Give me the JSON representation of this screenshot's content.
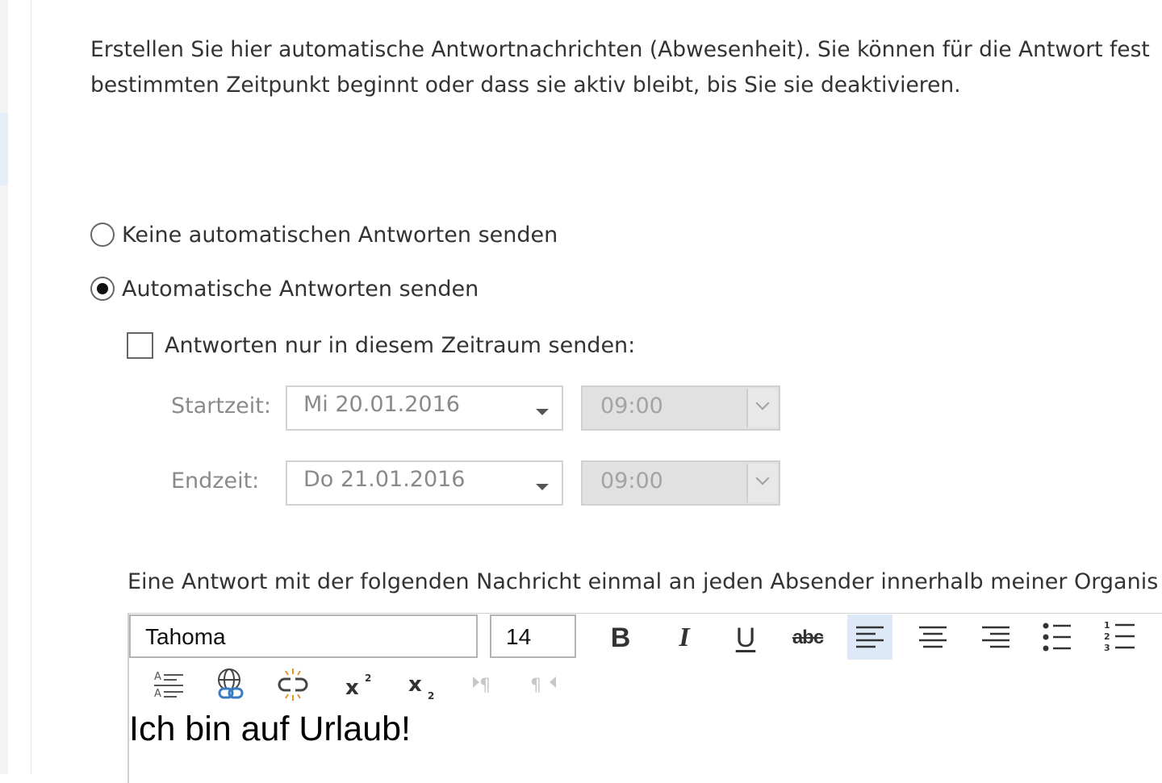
{
  "intro": {
    "line1": "Erstellen Sie hier automatische Antwortnachrichten (Abwesenheit). Sie können für die Antwort fest",
    "line2": "bestimmten Zeitpunkt beginnt oder dass sie aktiv bleibt, bis Sie sie deaktivieren."
  },
  "options": {
    "no_reply": {
      "label": "Keine automatischen Antworten senden",
      "checked": false
    },
    "auto_reply": {
      "label": "Automatische Antworten senden",
      "checked": true
    }
  },
  "time_range": {
    "checkbox_label": "Antworten nur in diesem Zeitraum senden:",
    "checked": false,
    "start": {
      "label": "Startzeit:",
      "date": "Mi 20.01.2016",
      "time": "09:00"
    },
    "end": {
      "label": "Endzeit:",
      "date": "Do 21.01.2016",
      "time": "09:00"
    }
  },
  "reply_label": "Eine Antwort mit der folgenden Nachricht einmal an jeden Absender innerhalb meiner Organis",
  "editor": {
    "font": "Tahoma",
    "size": "14",
    "toolbar": {
      "bold": "B",
      "italic": "I",
      "underline": "U",
      "strikethrough": "abc"
    },
    "content": "Ich bin auf Urlaub!"
  },
  "colors": {
    "accent_active": "#dde9f6",
    "link_icon_blue": "#3a7cc2",
    "unlink_icon_orange": "#e8922c"
  }
}
